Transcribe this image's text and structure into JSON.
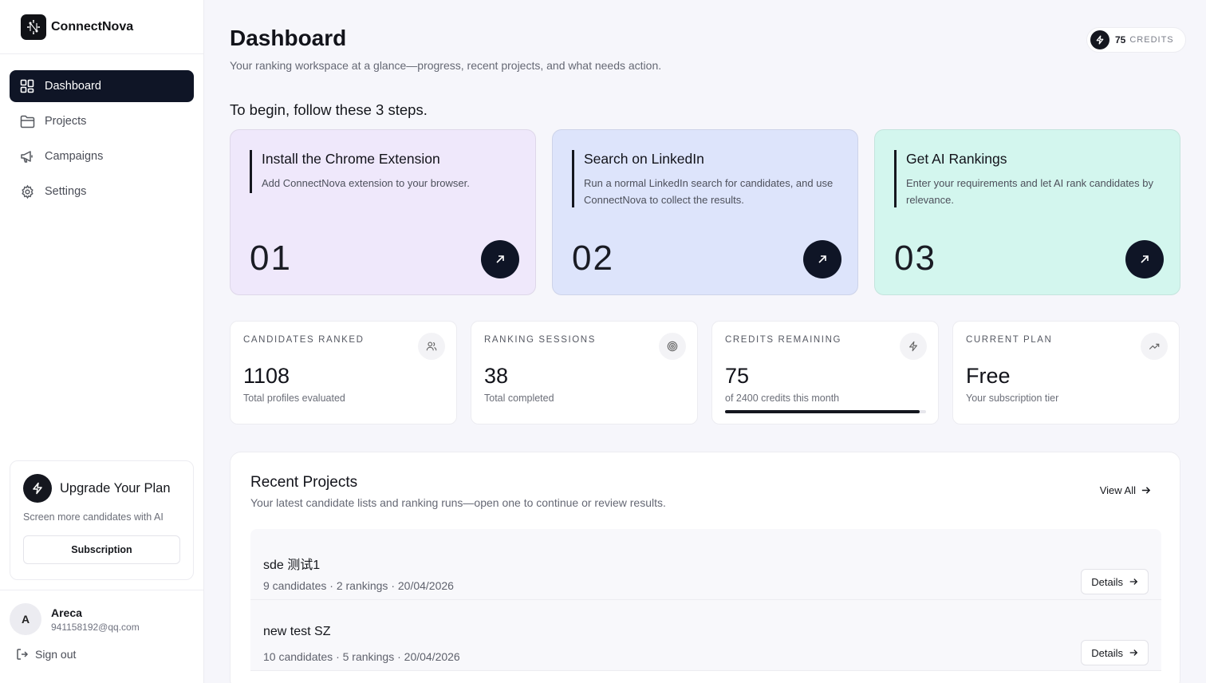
{
  "brand": {
    "name": "ConnectNova",
    "logo_icon": "network-logo-icon"
  },
  "sidebar": {
    "items": [
      {
        "label": "Dashboard",
        "icon": "grid-icon",
        "active": true
      },
      {
        "label": "Projects",
        "icon": "folder-icon",
        "active": false
      },
      {
        "label": "Campaigns",
        "icon": "megaphone-icon",
        "active": false
      },
      {
        "label": "Settings",
        "icon": "gear-icon",
        "active": false
      }
    ],
    "upgrade": {
      "title": "Upgrade Your Plan",
      "description": "Screen more candidates with AI",
      "button_label": "Subscription"
    },
    "user": {
      "initial": "A",
      "name": "Areca",
      "email": "941158192@qq.com"
    },
    "signout_label": "Sign out"
  },
  "header": {
    "title": "Dashboard",
    "subtitle": "Your ranking workspace at a glance—progress, recent projects, and what needs action.",
    "credits": {
      "value": "75",
      "label": "CREDITS"
    }
  },
  "steps": {
    "heading": "To begin, follow these 3 steps.",
    "items": [
      {
        "number": "01",
        "title": "Install the Chrome Extension",
        "description": "Add ConnectNova extension to your browser.",
        "color": "#efe8fb"
      },
      {
        "number": "02",
        "title": "Search on LinkedIn",
        "description": "Run a normal LinkedIn search for candidates, and use ConnectNova to collect the results.",
        "color": "#dde4fb"
      },
      {
        "number": "03",
        "title": "Get AI Rankings",
        "description": "Enter your requirements and let AI rank candidates by relevance.",
        "color": "#d3f6ee"
      }
    ]
  },
  "stats": [
    {
      "label": "CANDIDATES RANKED",
      "value": "1108",
      "sub": "Total profiles evaluated",
      "icon": "users-icon"
    },
    {
      "label": "RANKING SESSIONS",
      "value": "38",
      "sub": "Total completed",
      "icon": "target-icon"
    },
    {
      "label": "CREDITS REMAINING",
      "value": "75",
      "sub": "of 2400 credits this month",
      "icon": "bolt-icon",
      "progress": 0.97
    },
    {
      "label": "CURRENT PLAN",
      "value": "Free",
      "sub": "Your subscription tier",
      "icon": "trend-icon"
    }
  ],
  "recent": {
    "title": "Recent Projects",
    "subtitle": "Your latest candidate lists and ranking runs—open one to continue or review results.",
    "view_all_label": "View All",
    "projects": [
      {
        "name": "sde 测试1",
        "meta": "9 candidates · 2 rankings · 20/04/2026",
        "button_label": "Details"
      },
      {
        "name": "new test SZ",
        "meta": "10 candidates · 5 rankings · 20/04/2026",
        "button_label": "Details"
      }
    ]
  }
}
